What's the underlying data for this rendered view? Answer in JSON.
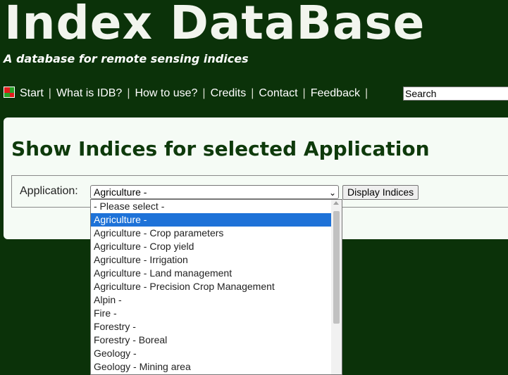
{
  "header": {
    "title": "Index DataBase",
    "subtitle": "A database for remote sensing indices"
  },
  "nav": {
    "items": [
      {
        "label": "Start",
        "icon": "start-icon"
      },
      {
        "label": "What is IDB?"
      },
      {
        "label": "How to use?"
      },
      {
        "label": "Credits"
      },
      {
        "label": "Contact"
      },
      {
        "label": "Feedback"
      }
    ],
    "separator": "|",
    "search": {
      "value": "Search",
      "placeholder": "Search"
    }
  },
  "panel": {
    "title": "Show Indices for selected Application",
    "application_label": "Application:",
    "selected_value": "Agriculture -",
    "button_label": "Display Indices"
  },
  "dropdown": {
    "options": [
      "- Please select -",
      "Agriculture -",
      "Agriculture - Crop parameters",
      "Agriculture - Crop yield",
      "Agriculture - Irrigation",
      "Agriculture - Land management",
      "Agriculture - Precision Crop Management",
      "Alpin -",
      "Fire -",
      "Forestry -",
      "Forestry - Boreal",
      "Geology -",
      "Geology - Mining area"
    ],
    "selected_index": 1
  },
  "colors": {
    "background": "#0b3209",
    "panel": "#f5fbf5",
    "selection": "#1e72d8"
  }
}
